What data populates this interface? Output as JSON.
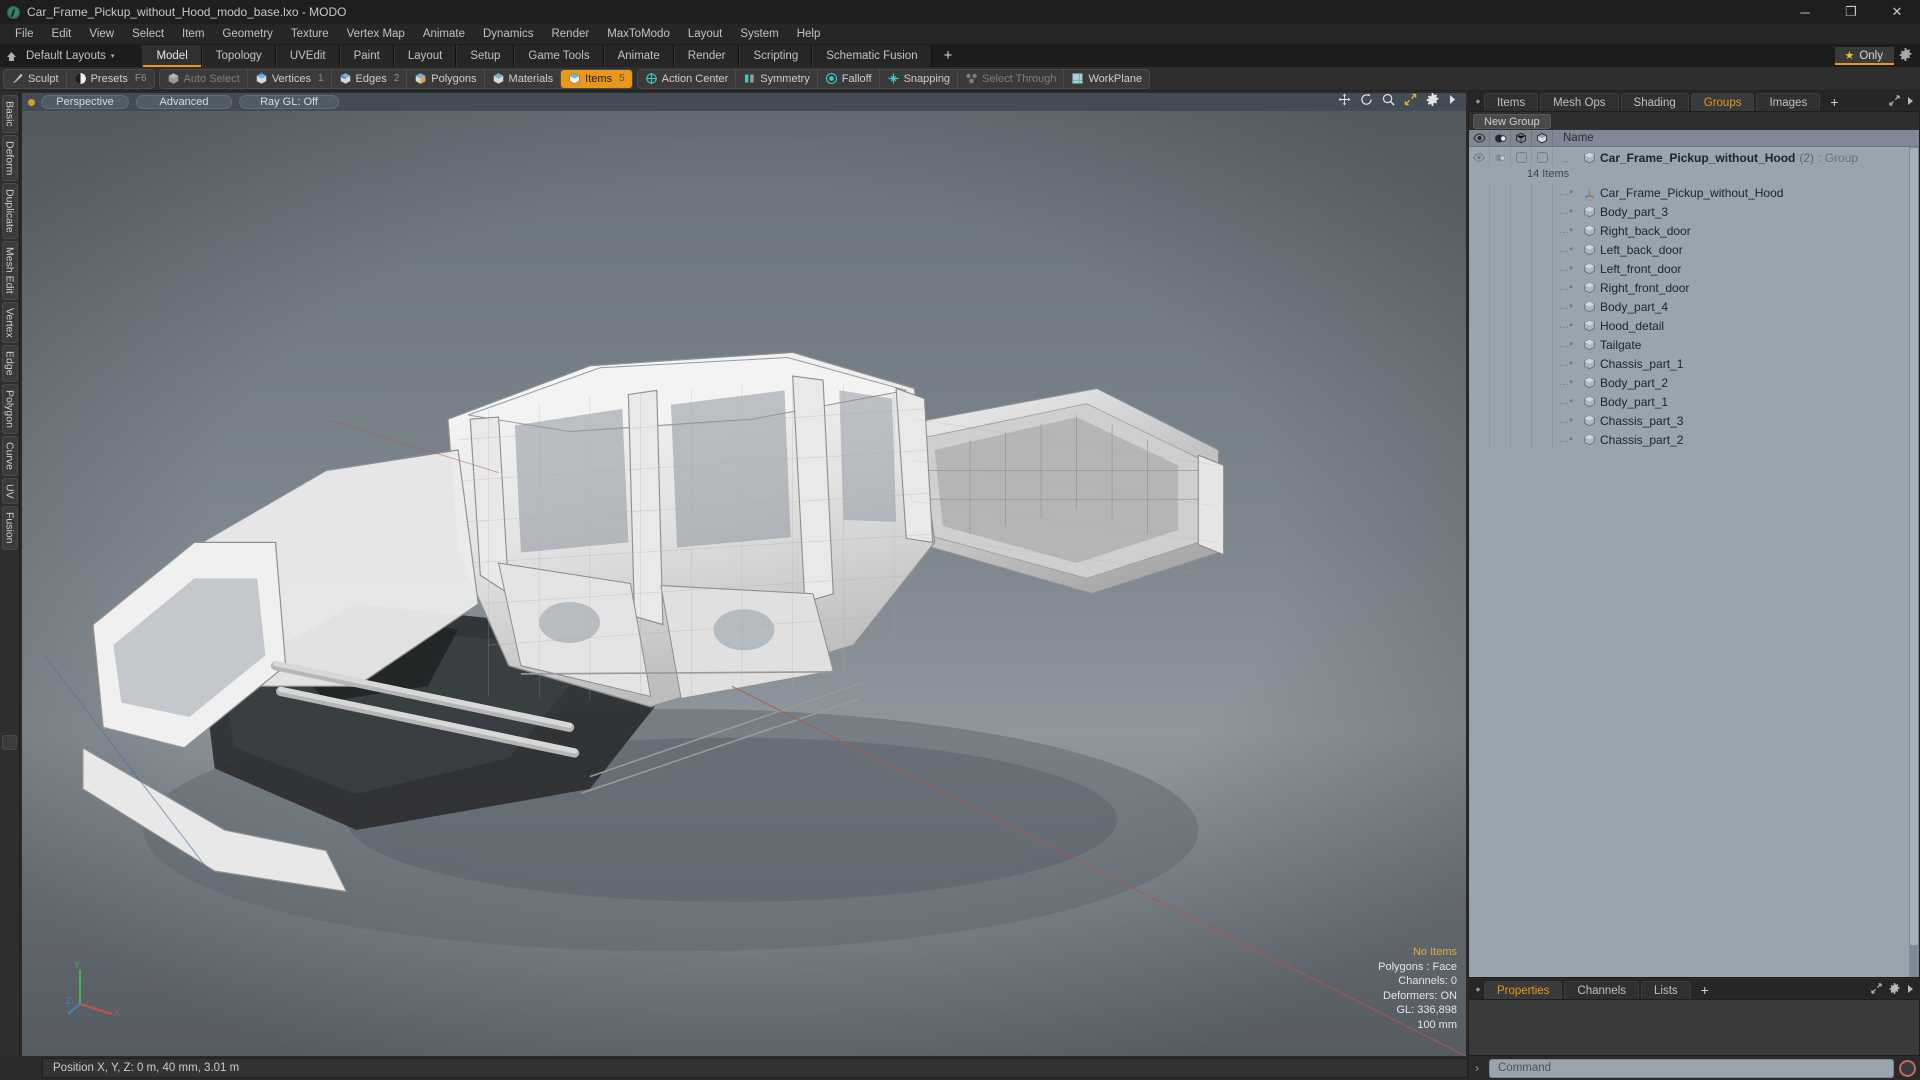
{
  "window": {
    "title": "Car_Frame_Pickup_without_Hood_modo_base.lxo - MODO",
    "app_icon": "modo-logo-icon",
    "minimize": "─",
    "maximize": "❐",
    "close": "✕"
  },
  "menubar": {
    "items": [
      "File",
      "Edit",
      "View",
      "Select",
      "Item",
      "Geometry",
      "Texture",
      "Vertex Map",
      "Animate",
      "Dynamics",
      "Render",
      "MaxToModo",
      "Layout",
      "System",
      "Help"
    ]
  },
  "layoutbar": {
    "home_icon": "home-icon",
    "layout_label": "Default Layouts",
    "caret": "▾",
    "tabs": [
      {
        "label": "Model",
        "active": true
      },
      {
        "label": "Topology",
        "active": false
      },
      {
        "label": "UVEdit",
        "active": false
      },
      {
        "label": "Paint",
        "active": false
      },
      {
        "label": "Layout",
        "active": false
      },
      {
        "label": "Setup",
        "active": false
      },
      {
        "label": "Game Tools",
        "active": false
      },
      {
        "label": "Animate",
        "active": false
      },
      {
        "label": "Render",
        "active": false
      },
      {
        "label": "Scripting",
        "active": false
      },
      {
        "label": "Schematic Fusion",
        "active": false
      }
    ],
    "add_tab": "+",
    "only_label": "Only",
    "star_icon": "star-icon",
    "gear_icon": "gear-icon"
  },
  "modebar": {
    "group1": [
      {
        "label": "Sculpt",
        "icon": "sculpt-brush-icon",
        "num": "",
        "state": "normal"
      },
      {
        "label": "Presets",
        "icon": "presets-sphere-icon",
        "num": "F6",
        "state": "normal"
      }
    ],
    "group2": [
      {
        "label": "Auto Select",
        "icon": "cube-grey-icon",
        "num": "",
        "state": "dim"
      },
      {
        "label": "Vertices",
        "icon": "cube-vertex-icon",
        "num": "1",
        "state": "normal"
      },
      {
        "label": "Edges",
        "icon": "cube-edge-icon",
        "num": "2",
        "state": "normal"
      },
      {
        "label": "Polygons",
        "icon": "cube-polygon-icon",
        "num": "",
        "state": "normal"
      },
      {
        "label": "Materials",
        "icon": "cube-material-icon",
        "num": "",
        "state": "normal"
      },
      {
        "label": "Items",
        "icon": "cube-items-icon",
        "num": "5",
        "state": "selected"
      }
    ],
    "group3": [
      {
        "label": "Action Center",
        "icon": "action-center-icon",
        "num": "",
        "state": "normal"
      },
      {
        "label": "Symmetry",
        "icon": "symmetry-icon",
        "num": "",
        "state": "normal"
      },
      {
        "label": "Falloff",
        "icon": "falloff-icon",
        "num": "",
        "state": "normal"
      },
      {
        "label": "Snapping",
        "icon": "snapping-icon",
        "num": "",
        "state": "normal"
      },
      {
        "label": "Select Through",
        "icon": "select-through-icon",
        "num": "",
        "state": "dim"
      },
      {
        "label": "WorkPlane",
        "icon": "workplane-icon",
        "num": "",
        "state": "normal"
      }
    ]
  },
  "left_tabs": [
    "Basic",
    "Deform",
    "Duplicate",
    "Mesh Edit",
    "Vertex",
    "Edge",
    "Polygon",
    "Curve",
    "UV",
    "Fusion"
  ],
  "viewport": {
    "indicator_dot": "active-dot",
    "view_mode": "Perspective",
    "shading": "Advanced",
    "raygl": "Ray GL: Off",
    "nav_icons": [
      "pan-icon",
      "rotate-icon",
      "zoom-icon",
      "fit-icon",
      "gear-icon",
      "chevron-right-icon"
    ],
    "stats": {
      "selection": "No Items",
      "polygons": "Polygons : Face",
      "channels": "Channels: 0",
      "deformers": "Deformers: ON",
      "gl": "GL: 336,898",
      "grid": "100 mm"
    },
    "gizmo_axes": [
      "X",
      "Y",
      "Z"
    ]
  },
  "right_panel": {
    "bullet": "●",
    "tabs": [
      {
        "label": "Items",
        "active": false
      },
      {
        "label": "Mesh Ops",
        "active": false
      },
      {
        "label": "Shading",
        "active": false
      },
      {
        "label": "Groups",
        "active": true
      },
      {
        "label": "Images",
        "active": false
      }
    ],
    "add_tab": "+",
    "expand_icon": "expand-icon",
    "more_icon": "chevron-right-icon",
    "new_group_button": "New Group",
    "columns": [
      {
        "icon": "eye-icon",
        "name": "visibility-column"
      },
      {
        "icon": "render-icon",
        "name": "render-column"
      },
      {
        "icon": "cube-outline-icon",
        "name": "wireframe-column"
      },
      {
        "icon": "cube-shaded-icon",
        "name": "shading-column"
      }
    ],
    "name_header": "Name",
    "group": {
      "name": "Car_Frame_Pickup_without_Hood",
      "count": "(2)",
      "type": ": Group",
      "item_count_label": "14 Items",
      "icon": "group-cube-icon"
    },
    "items": [
      {
        "label": "Car_Frame_Pickup_without_Hood",
        "icon": "locator-axis-icon"
      },
      {
        "label": "Body_part_3",
        "icon": "mesh-cube-icon"
      },
      {
        "label": "Right_back_door",
        "icon": "mesh-cube-icon"
      },
      {
        "label": "Left_back_door",
        "icon": "mesh-cube-icon"
      },
      {
        "label": "Left_front_door",
        "icon": "mesh-cube-icon"
      },
      {
        "label": "Right_front_door",
        "icon": "mesh-cube-icon"
      },
      {
        "label": "Body_part_4",
        "icon": "mesh-cube-icon"
      },
      {
        "label": "Hood_detail",
        "icon": "mesh-cube-icon"
      },
      {
        "label": "Tailgate",
        "icon": "mesh-cube-icon"
      },
      {
        "label": "Chassis_part_1",
        "icon": "mesh-cube-icon"
      },
      {
        "label": "Body_part_2",
        "icon": "mesh-cube-icon"
      },
      {
        "label": "Body_part_1",
        "icon": "mesh-cube-icon"
      },
      {
        "label": "Chassis_part_3",
        "icon": "mesh-cube-icon"
      },
      {
        "label": "Chassis_part_2",
        "icon": "mesh-cube-icon"
      }
    ]
  },
  "properties_panel": {
    "bullet": "●",
    "tabs": [
      {
        "label": "Properties",
        "active": true
      },
      {
        "label": "Channels",
        "active": false
      },
      {
        "label": "Lists",
        "active": false
      }
    ],
    "add_tab": "+",
    "expand_icon": "expand-icon",
    "gear_icon": "gear-icon",
    "more_icon": "chevron-right-icon"
  },
  "statusbar": {
    "position_text": "Position X, Y, Z:   0 m, 40 mm, 3.01 m"
  },
  "commandbar": {
    "prompt": "›",
    "placeholder": "Command",
    "record_icon": "record-icon"
  },
  "colors": {
    "accent": "#e8991b",
    "panel_bg": "#2a2a2a",
    "list_bg": "#9aa4af",
    "viewport_top": "#6a737c"
  }
}
